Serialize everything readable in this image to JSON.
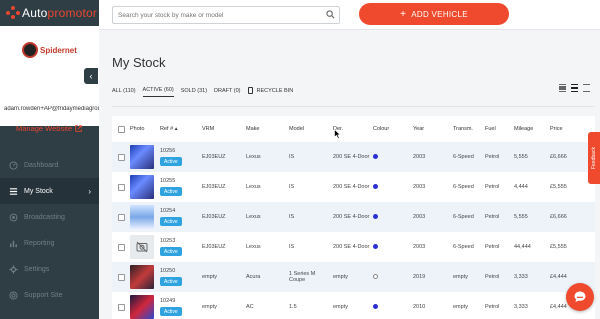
{
  "app": {
    "brand_prefix": "Auto",
    "brand_suffix": "promotor"
  },
  "sidebar": {
    "logo_text": "Spidernet",
    "user_email": "adam.rowden+AP@fridaymediagroup.c",
    "manage_website": "Manage Website",
    "items": [
      {
        "label": "Dashboard",
        "icon": "speedometer-icon"
      },
      {
        "label": "My Stock",
        "icon": "list-icon",
        "active": true
      },
      {
        "label": "Broadcasting",
        "icon": "broadcast-icon"
      },
      {
        "label": "Reporting",
        "icon": "bar-chart-icon"
      },
      {
        "label": "Settings",
        "icon": "gear-icon"
      },
      {
        "label": "Support Site",
        "icon": "support-icon"
      }
    ]
  },
  "search": {
    "placeholder": "Search your stock by make or model"
  },
  "add_vehicle": "ADD VEHICLE",
  "page_title": "My Stock",
  "filters": {
    "all": "ALL (110)",
    "active": "ACTIVE (60)",
    "sold": "SOLD (31)",
    "draft": "DRAFT (0)",
    "recycle_bin": "RECYCLE BIN"
  },
  "table": {
    "headers": {
      "photo": "Photo",
      "ref": "Ref #",
      "vrm": "VRM",
      "make": "Make",
      "model": "Model",
      "der": "Der.",
      "colour": "Colour",
      "year": "Year",
      "trans": "Transm.",
      "fuel": "Fuel",
      "mileage": "Mileage",
      "price": "Price"
    },
    "rows": [
      {
        "ref": "10256",
        "status": "Active",
        "vrm": "EJ03EUZ",
        "make": "Lexus",
        "model": "IS",
        "der": "200 SE 4-Door",
        "year": "2003",
        "trans": "6-Speed",
        "fuel": "Petrol",
        "mileage": "5,555",
        "price": "£6,666",
        "thumb": "blue",
        "colour": "blue"
      },
      {
        "ref": "10255",
        "status": "Active",
        "vrm": "EJ03EUZ",
        "make": "Lexus",
        "model": "IS",
        "der": "200 SE 4-Door",
        "year": "2003",
        "trans": "6-Speed",
        "fuel": "Petrol",
        "mileage": "4,444",
        "price": "£5,555",
        "thumb": "blue",
        "colour": "blue"
      },
      {
        "ref": "10254",
        "status": "Active",
        "vrm": "EJ03EUZ",
        "make": "Lexus",
        "model": "IS",
        "der": "200 SE 4-Door",
        "year": "2003",
        "trans": "6-Speed",
        "fuel": "Petrol",
        "mileage": "5,555",
        "price": "£6,666",
        "thumb": "sky",
        "colour": "blue"
      },
      {
        "ref": "10253",
        "status": "Active",
        "vrm": "EJ03EUZ",
        "make": "Lexus",
        "model": "IS",
        "der": "200 SE 4-Door",
        "year": "2003",
        "trans": "6-Speed",
        "fuel": "Petrol",
        "mileage": "44,444",
        "price": "£5,555",
        "thumb": "none",
        "colour": "blue"
      },
      {
        "ref": "10250",
        "status": "Active",
        "vrm": "empty",
        "make": "Acura",
        "model": "1 Series M Coupe",
        "der": "empty",
        "year": "2019",
        "trans": "empty",
        "fuel": "Petrol",
        "mileage": "3,333",
        "price": "£4,444",
        "thumb": "dark",
        "colour": "empty"
      },
      {
        "ref": "10249",
        "status": "Active",
        "vrm": "empty",
        "make": "AC",
        "model": "1.5",
        "der": "empty",
        "year": "2010",
        "trans": "empty",
        "fuel": "Petrol",
        "mileage": "3,333",
        "price": "£4,444",
        "thumb": "red",
        "colour": "blue"
      }
    ]
  },
  "feedback": "Feedback",
  "colors": {
    "accent": "#ef4a2d",
    "sidebar": "#2f3d45",
    "badge": "#2fa3e0",
    "row_alt": "#eef3fa"
  }
}
